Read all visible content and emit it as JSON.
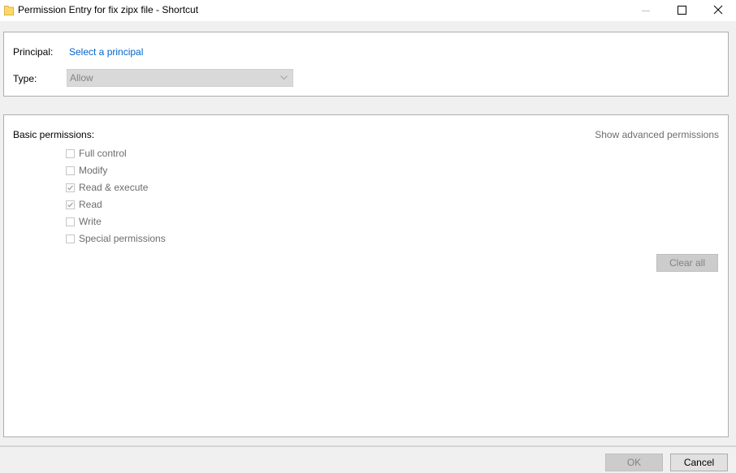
{
  "window": {
    "title": "Permission Entry for fix zipx file - Shortcut",
    "icon": "folder-icon",
    "controls": [
      "minimize-icon",
      "maximize-icon",
      "close-icon"
    ]
  },
  "principal": {
    "label": "Principal:",
    "link": "Select a principal"
  },
  "type": {
    "label": "Type:",
    "value": "Allow",
    "enabled": false
  },
  "permissions": {
    "heading": "Basic permissions:",
    "advanced_link": "Show advanced permissions",
    "items": [
      {
        "label": "Full control",
        "checked": false
      },
      {
        "label": "Modify",
        "checked": false
      },
      {
        "label": "Read & execute",
        "checked": true
      },
      {
        "label": "Read",
        "checked": true
      },
      {
        "label": "Write",
        "checked": false
      },
      {
        "label": "Special permissions",
        "checked": false
      }
    ],
    "clear_all": "Clear all"
  },
  "footer": {
    "ok": "OK",
    "cancel": "Cancel"
  },
  "colors": {
    "link": "#0066cc",
    "disabled_text": "#838383",
    "panel_border": "#adadad",
    "background": "#f0f0f0"
  }
}
